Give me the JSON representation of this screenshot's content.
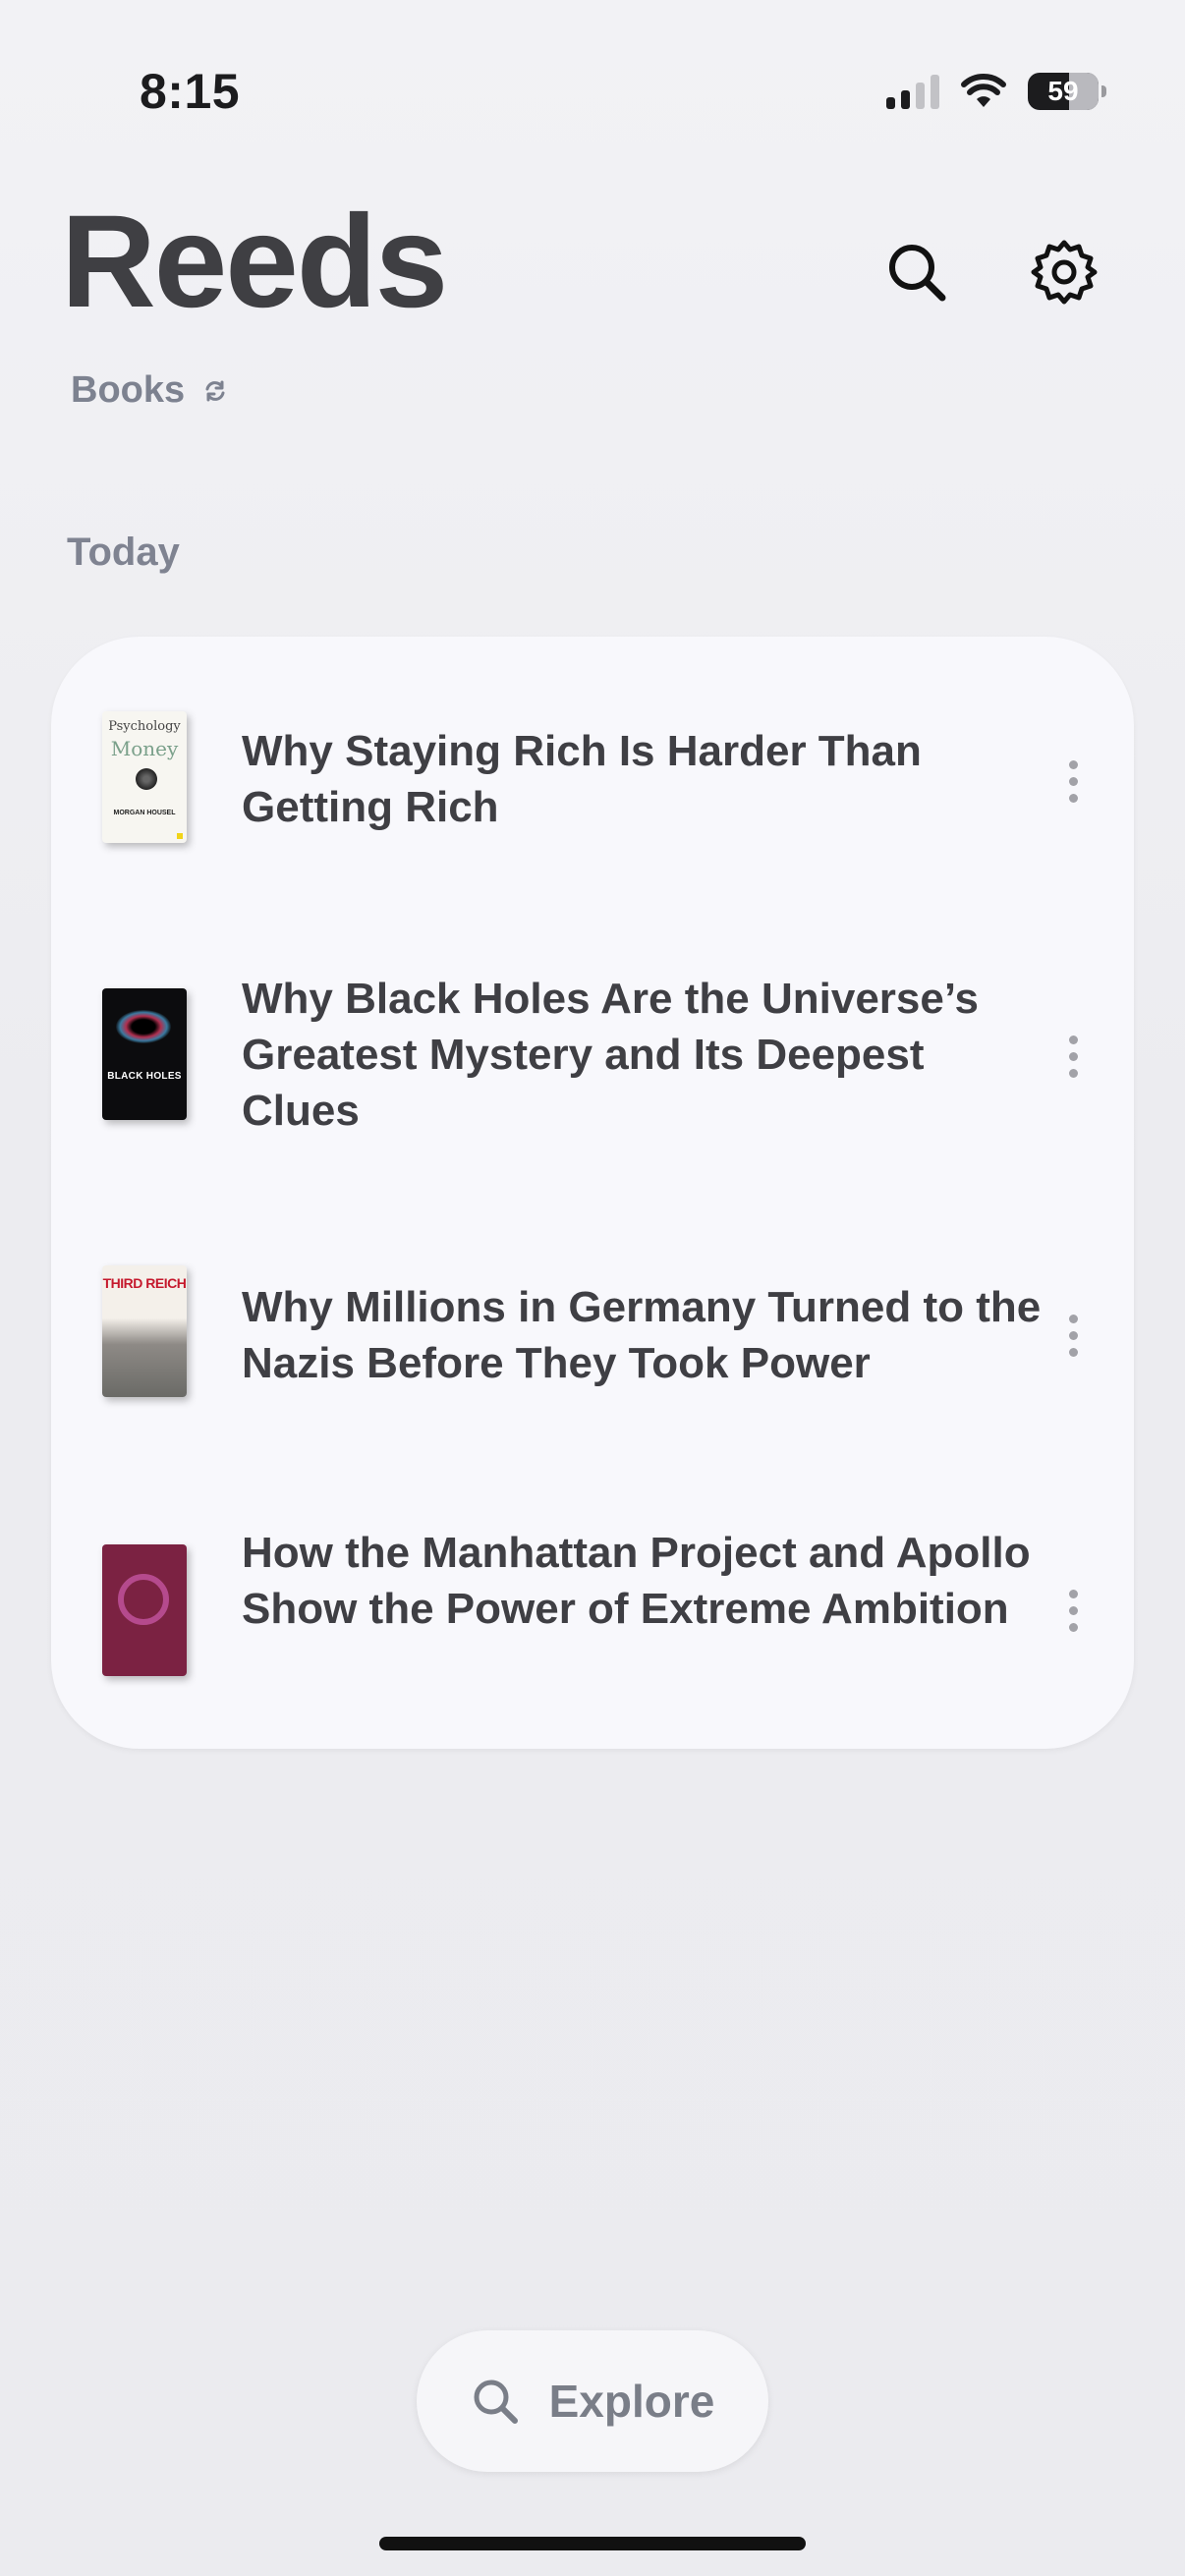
{
  "status_bar": {
    "time": "8:15",
    "battery": "59",
    "icons": [
      "cellular-signal-icon",
      "wifi-icon",
      "battery-icon"
    ]
  },
  "header": {
    "title": "Reeds",
    "subtitle": "Books",
    "icons": [
      "search-icon",
      "gear-icon",
      "refresh-icon"
    ]
  },
  "section": {
    "label": "Today"
  },
  "books": [
    {
      "title": "Why Staying Rich Is Harder Than Getting Rich",
      "cover": "The Psychology of Money",
      "cover_title_line1": "Psychology",
      "cover_title_line2": "Money",
      "cover_author": "MORGAN HOUSEL"
    },
    {
      "title": "Why Black Holes Are the Universe’s Greatest Mystery and Its Deepest Clues",
      "cover": "Black Holes",
      "cover_title": "BLACK HOLES"
    },
    {
      "title": "Why Millions in Germany Turned to the Nazis Before They Took Power",
      "cover": "The Third Reich",
      "cover_title": "THIRD REICH"
    },
    {
      "title": "How the Manhattan Project and Apollo Show the Power of Extreme Ambition",
      "cover": "Manhattan Project book"
    }
  ],
  "bottom": {
    "explore_label": "Explore"
  },
  "colors": {
    "background": "#f2f2f5",
    "card": "#f8f8fc",
    "title_text": "#3f3f43",
    "secondary_text": "#7d8290"
  }
}
